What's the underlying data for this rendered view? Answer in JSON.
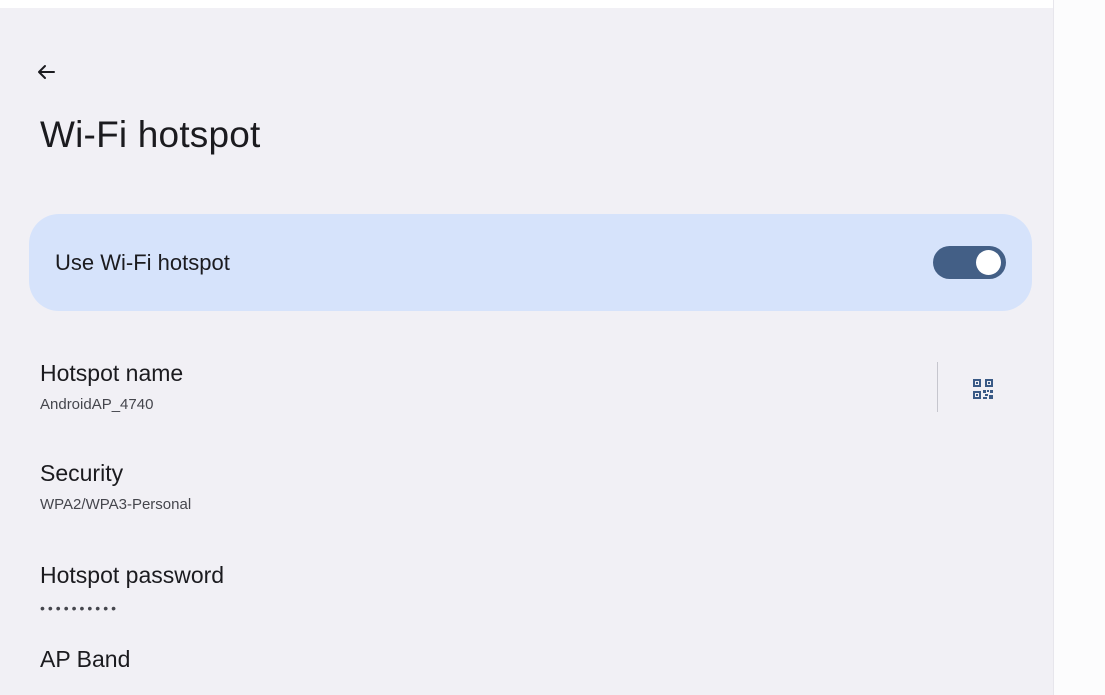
{
  "header": {
    "title": "Wi-Fi hotspot",
    "back_icon": "arrow-back-icon"
  },
  "main_switch": {
    "label": "Use Wi-Fi hotspot",
    "checked": true,
    "colors": {
      "card": "#d6e3fb",
      "track": "#435f86",
      "thumb": "#ffffff"
    }
  },
  "preferences": [
    {
      "title": "Hotspot name",
      "summary": "AndroidAP_4740",
      "icon": "qr-code-icon"
    },
    {
      "title": "Security",
      "summary": "WPA2/WPA3-Personal"
    },
    {
      "title": "Hotspot password",
      "summary": "••••••••••"
    },
    {
      "title": "AP Band"
    }
  ]
}
